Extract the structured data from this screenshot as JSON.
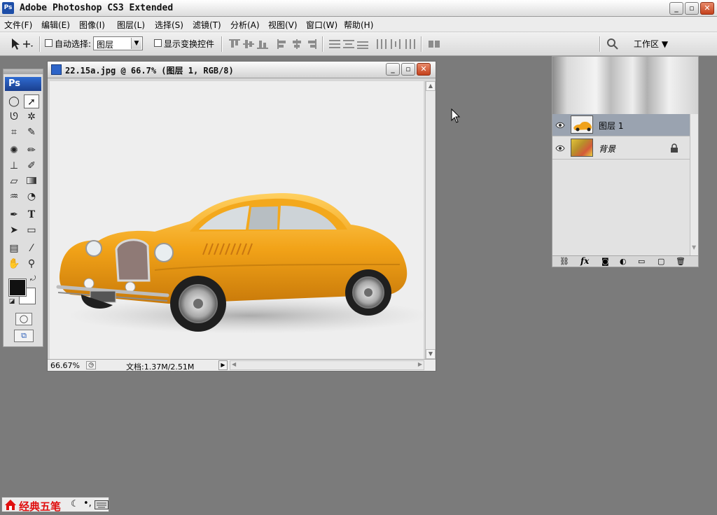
{
  "app": {
    "title": "Adobe Photoshop CS3 Extended",
    "logo": "Ps"
  },
  "window_controls": {
    "minimize": "_",
    "maximize": "▫",
    "close": "✕"
  },
  "menu": [
    "文件(F)",
    "编辑(E)",
    "图像(I)",
    "图层(L)",
    "选择(S)",
    "滤镜(T)",
    "分析(A)",
    "视图(V)",
    "窗口(W)",
    "帮助(H)"
  ],
  "options_bar": {
    "auto_select_label": "自动选择:",
    "auto_select_value": "图层",
    "show_transform_label": "显示变换控件",
    "workspace_label": "工作区 ▼"
  },
  "toolbox": {
    "logo": "Ps",
    "foreground_color": "#111111",
    "background_color": "#ffffff"
  },
  "document": {
    "title": "22.15a.jpg @ 66.7% (图层 1, RGB/8)",
    "zoom": "66.67%",
    "doc_size": "文档:1.37M/2.51M",
    "car_color": "#f0a21b"
  },
  "layers": {
    "rows": [
      {
        "name": "图层 1",
        "selected": true
      },
      {
        "name": "背景",
        "locked": true
      }
    ],
    "footer_icons": [
      "link-icon",
      "fx-icon",
      "mask-icon",
      "adjustment-icon",
      "group-icon",
      "new-layer-icon",
      "trash-icon"
    ]
  },
  "ime": {
    "name": "经典五笔"
  }
}
